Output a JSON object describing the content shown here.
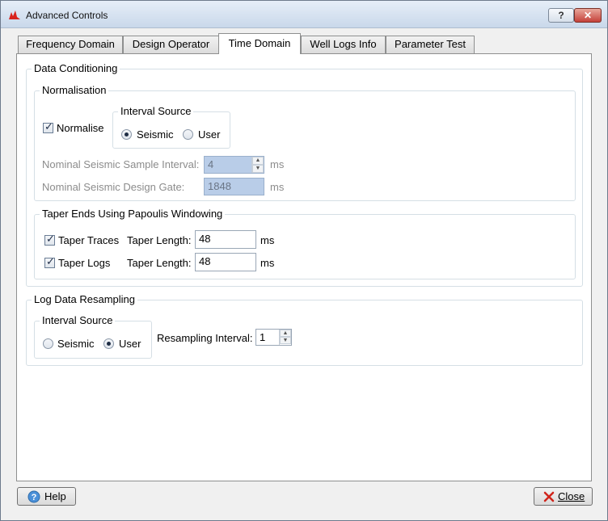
{
  "window": {
    "title": "Advanced Controls",
    "help_glyph": "?",
    "close_glyph": "✕"
  },
  "tabs": [
    "Frequency Domain",
    "Design Operator",
    "Time Domain",
    "Well Logs Info",
    "Parameter Test"
  ],
  "active_tab": "Time Domain",
  "data_conditioning": {
    "title": "Data Conditioning",
    "normalisation": {
      "title": "Normalisation",
      "normalise_label": "Normalise",
      "normalise_checked": true,
      "interval_source": {
        "title": "Interval Source",
        "seismic": "Seismic",
        "user": "User",
        "selected": "Seismic"
      },
      "sample_interval_label": "Nominal Seismic Sample Interval:",
      "sample_interval_value": "4",
      "sample_interval_unit": "ms",
      "design_gate_label": "Nominal Seismic Design Gate:",
      "design_gate_value": "1848",
      "design_gate_unit": "ms"
    },
    "taper": {
      "title": "Taper Ends Using Papoulis Windowing",
      "traces_label": "Taper Traces",
      "traces_checked": true,
      "traces_length_label": "Taper Length:",
      "traces_length_value": "48",
      "traces_unit": "ms",
      "logs_label": "Taper Logs",
      "logs_checked": true,
      "logs_length_label": "Taper Length:",
      "logs_length_value": "48",
      "logs_unit": "ms"
    }
  },
  "log_resampling": {
    "title": "Log Data Resampling",
    "interval_source": {
      "title": "Interval Source",
      "seismic": "Seismic",
      "user": "User",
      "selected": "User"
    },
    "resampling_label": "Resampling Interval:",
    "resampling_value": "1"
  },
  "footer": {
    "help_label": "Help",
    "close_label": "Close"
  }
}
